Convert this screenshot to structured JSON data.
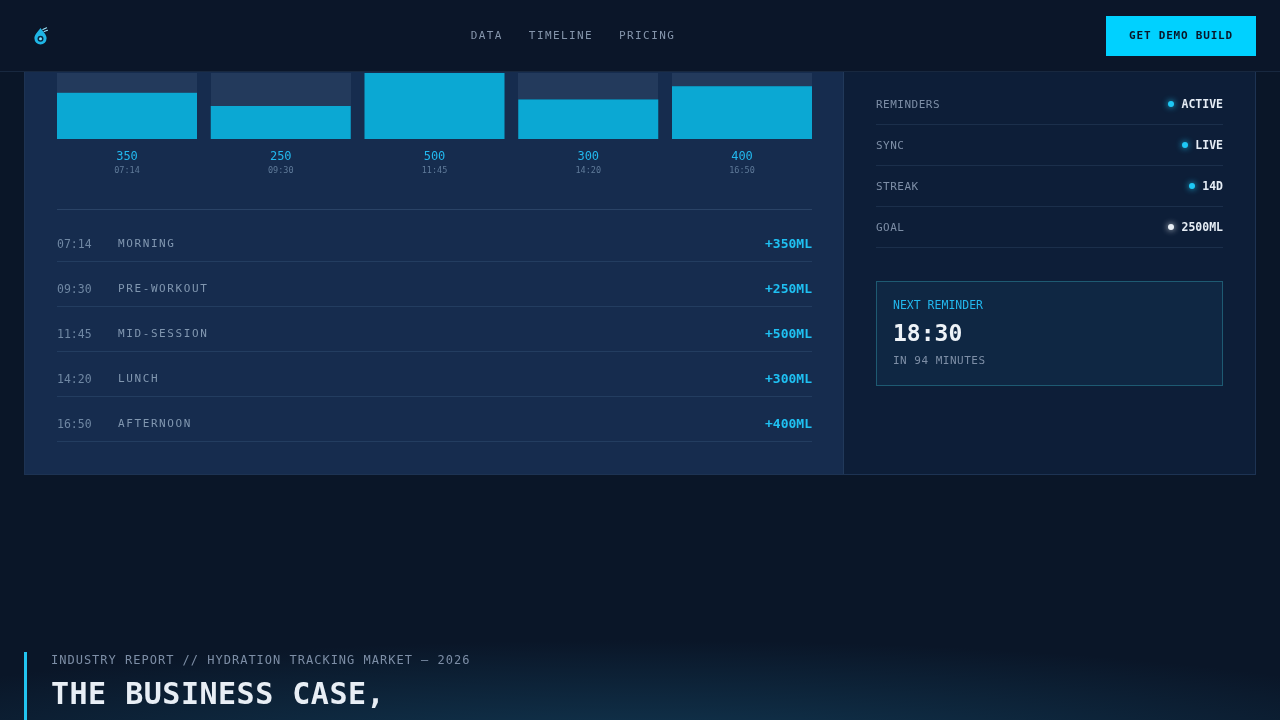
{
  "header": {
    "nav": [
      "DATA",
      "TIMELINE",
      "PRICING"
    ],
    "cta": "GET DEMO BUILD"
  },
  "dashboard": {
    "chart_data": [
      {
        "type": "bar",
        "categories": [
          "07:14",
          "09:30",
          "11:45",
          "14:20",
          "16:50"
        ],
        "values": [
          350,
          250,
          500,
          300,
          400
        ],
        "color": "#0ba8d3",
        "data_labels": true
      }
    ],
    "log": [
      {
        "time": "07:14",
        "label": "MORNING",
        "amount": "+350ML"
      },
      {
        "time": "09:30",
        "label": "PRE-WORKOUT",
        "amount": "+250ML"
      },
      {
        "time": "11:45",
        "label": "MID-SESSION",
        "amount": "+500ML"
      },
      {
        "time": "14:20",
        "label": "LUNCH",
        "amount": "+300ML"
      },
      {
        "time": "16:50",
        "label": "AFTERNOON",
        "amount": "+400ML"
      }
    ],
    "status": [
      {
        "label": "REMINDERS",
        "value": "ACTIVE",
        "color": "#1ec8f5"
      },
      {
        "label": "SYNC",
        "value": "LIVE",
        "color": "#1ec8f5"
      },
      {
        "label": "STREAK",
        "value": "14D",
        "color": "#1ec8f5"
      },
      {
        "label": "GOAL",
        "value": "2500ML",
        "color": "#e8eef5"
      }
    ],
    "next_reminder": {
      "label": "NEXT REMINDER",
      "time": "18:30",
      "note": "IN 94 MINUTES"
    }
  },
  "report": {
    "kicker": "INDUSTRY REPORT // HYDRATION TRACKING MARKET — 2026",
    "title": "THE BUSINESS CASE,"
  }
}
